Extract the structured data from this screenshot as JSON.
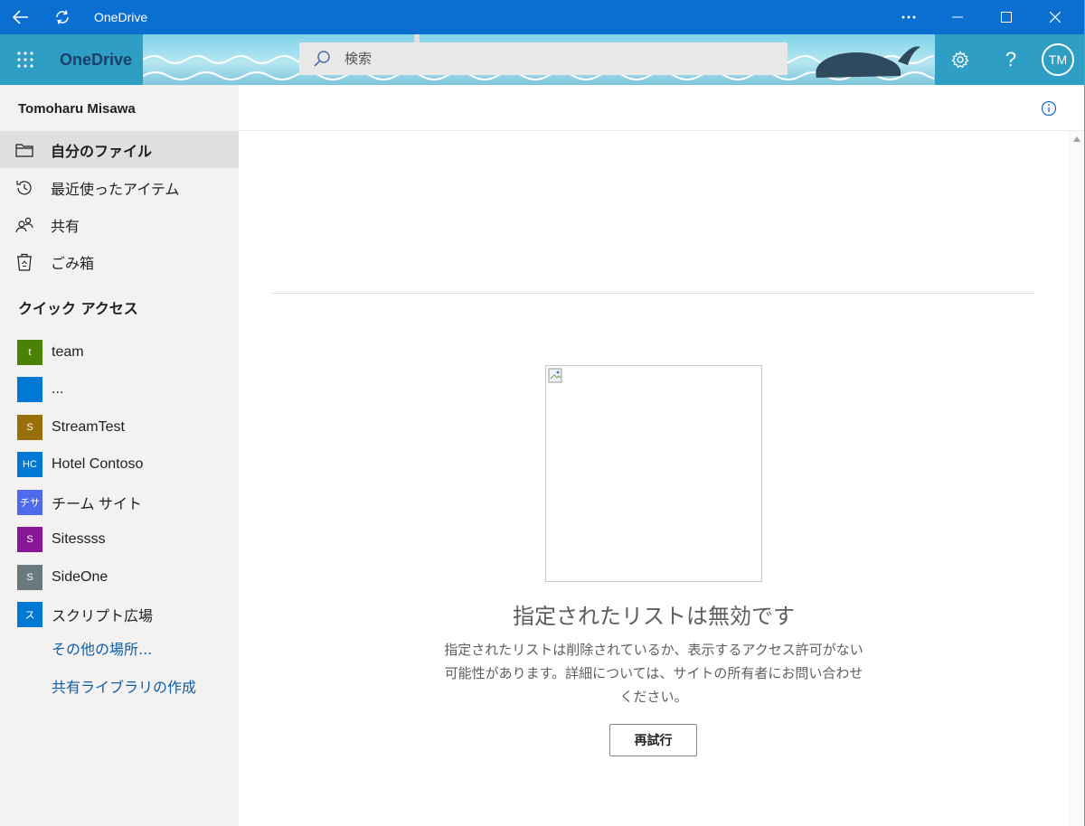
{
  "window": {
    "title": "OneDrive"
  },
  "suite": {
    "brand": "OneDrive",
    "search_placeholder": "検索",
    "avatar_initials": "TM"
  },
  "sidebar": {
    "user_name": "Tomoharu Misawa",
    "nav": [
      {
        "label": "自分のファイル",
        "icon": "folder-icon",
        "selected": true
      },
      {
        "label": "最近使ったアイテム",
        "icon": "history-icon",
        "selected": false
      },
      {
        "label": "共有",
        "icon": "people-icon",
        "selected": false
      },
      {
        "label": "ごみ箱",
        "icon": "recycle-bin-icon",
        "selected": false
      }
    ],
    "quick_access_title": "クイック アクセス",
    "quick_access": [
      {
        "initials": "t",
        "label": "team",
        "color": "#498205"
      },
      {
        "initials": "",
        "label": "...",
        "color": "#0078d4"
      },
      {
        "initials": "S",
        "label": "StreamTest",
        "color": "#986f0b"
      },
      {
        "initials": "HC",
        "label": "Hotel Contoso",
        "color": "#0078d4"
      },
      {
        "initials": "チサ",
        "label": "チーム サイト",
        "color": "#4f6bed"
      },
      {
        "initials": "S",
        "label": "Sitessss",
        "color": "#881798"
      },
      {
        "initials": "S",
        "label": "SideOne",
        "color": "#69797e"
      },
      {
        "initials": "ス",
        "label": "スクリプト広場",
        "color": "#0078d4"
      }
    ],
    "more_places": "その他の場所...",
    "create_library": "共有ライブラリの作成"
  },
  "main": {
    "error_title": "指定されたリストは無効です",
    "error_desc": "指定されたリストは削除されているか、表示するアクセス許可がない可能性があります。詳細については、サイトの所有者にお問い合わせください。",
    "retry_label": "再試行"
  },
  "colors": {
    "titlebar": "#0a6fd1",
    "sidebar_bg": "#f3f2f1",
    "link": "#0f5fa8"
  }
}
